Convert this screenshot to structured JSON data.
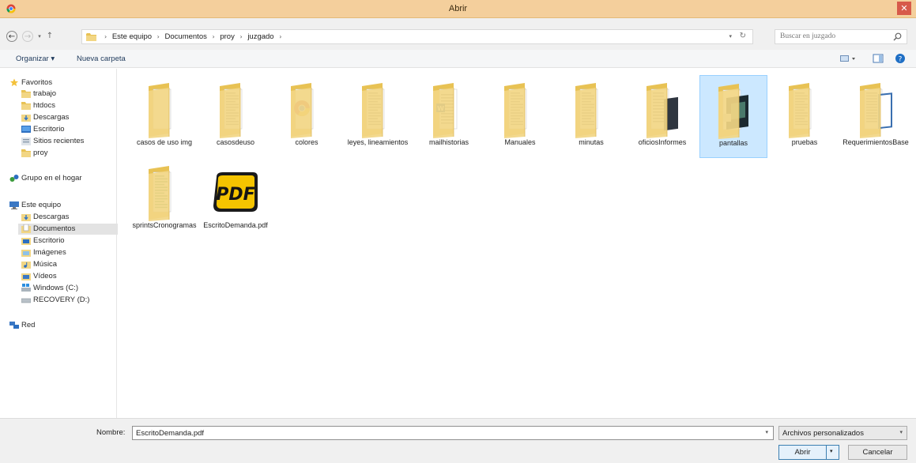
{
  "window": {
    "title": "Abrir",
    "close_glyph": "✕"
  },
  "address": {
    "crumbs": [
      "Este equipo",
      "Documentos",
      "proy",
      "juzgado"
    ],
    "search_placeholder": "Buscar en juzgado"
  },
  "toolbar": {
    "organize_label": "Organizar ▾",
    "new_folder_label": "Nueva carpeta"
  },
  "nav": {
    "favorites": {
      "label": "Favoritos",
      "items": [
        "trabajo",
        "htdocs",
        "Descargas",
        "Escritorio",
        "Sitios recientes",
        "proy"
      ]
    },
    "homegroup": "Grupo en el hogar",
    "this_pc": {
      "label": "Este equipo",
      "items": [
        "Descargas",
        "Documentos",
        "Escritorio",
        "Imágenes",
        "Música",
        "Vídeos",
        "Windows (C:)",
        "RECOVERY (D:)"
      ],
      "selected": "Documentos"
    },
    "network": "Red"
  },
  "files": [
    {
      "name": "casos de uso img",
      "kind": "folder",
      "content": "white"
    },
    {
      "name": "casosdeuso",
      "kind": "folder",
      "content": "doc"
    },
    {
      "name": "colores",
      "kind": "folder",
      "content": "chrome"
    },
    {
      "name": "leyes, lineamientos",
      "kind": "folder",
      "content": "doc"
    },
    {
      "name": "mailhistorias",
      "kind": "folder",
      "content": "word"
    },
    {
      "name": "Manuales",
      "kind": "folder",
      "content": "doc"
    },
    {
      "name": "minutas",
      "kind": "folder",
      "content": "doc"
    },
    {
      "name": "oficiosInformes",
      "kind": "folder",
      "content": "dark"
    },
    {
      "name": "pantallas",
      "kind": "folder",
      "content": "screens",
      "selected": true
    },
    {
      "name": "pruebas",
      "kind": "folder",
      "content": "doc"
    },
    {
      "name": "RequerimientosBase",
      "kind": "folder",
      "content": "blue"
    },
    {
      "name": "sprintsCronogramas",
      "kind": "folder",
      "content": "green"
    },
    {
      "name": "EscritoDemanda.pdf",
      "kind": "pdf",
      "badge": "PDF"
    }
  ],
  "bottom": {
    "filename_label": "Nombre:",
    "filename_value": "EscritoDemanda.pdf",
    "filter_value": "Archivos personalizados",
    "open_label": "Abrir",
    "cancel_label": "Cancelar"
  },
  "colors": {
    "title_bar": "#f4cf9c",
    "selection": "#cce8ff",
    "folder": "#f2d684",
    "close": "#d75a4a"
  }
}
